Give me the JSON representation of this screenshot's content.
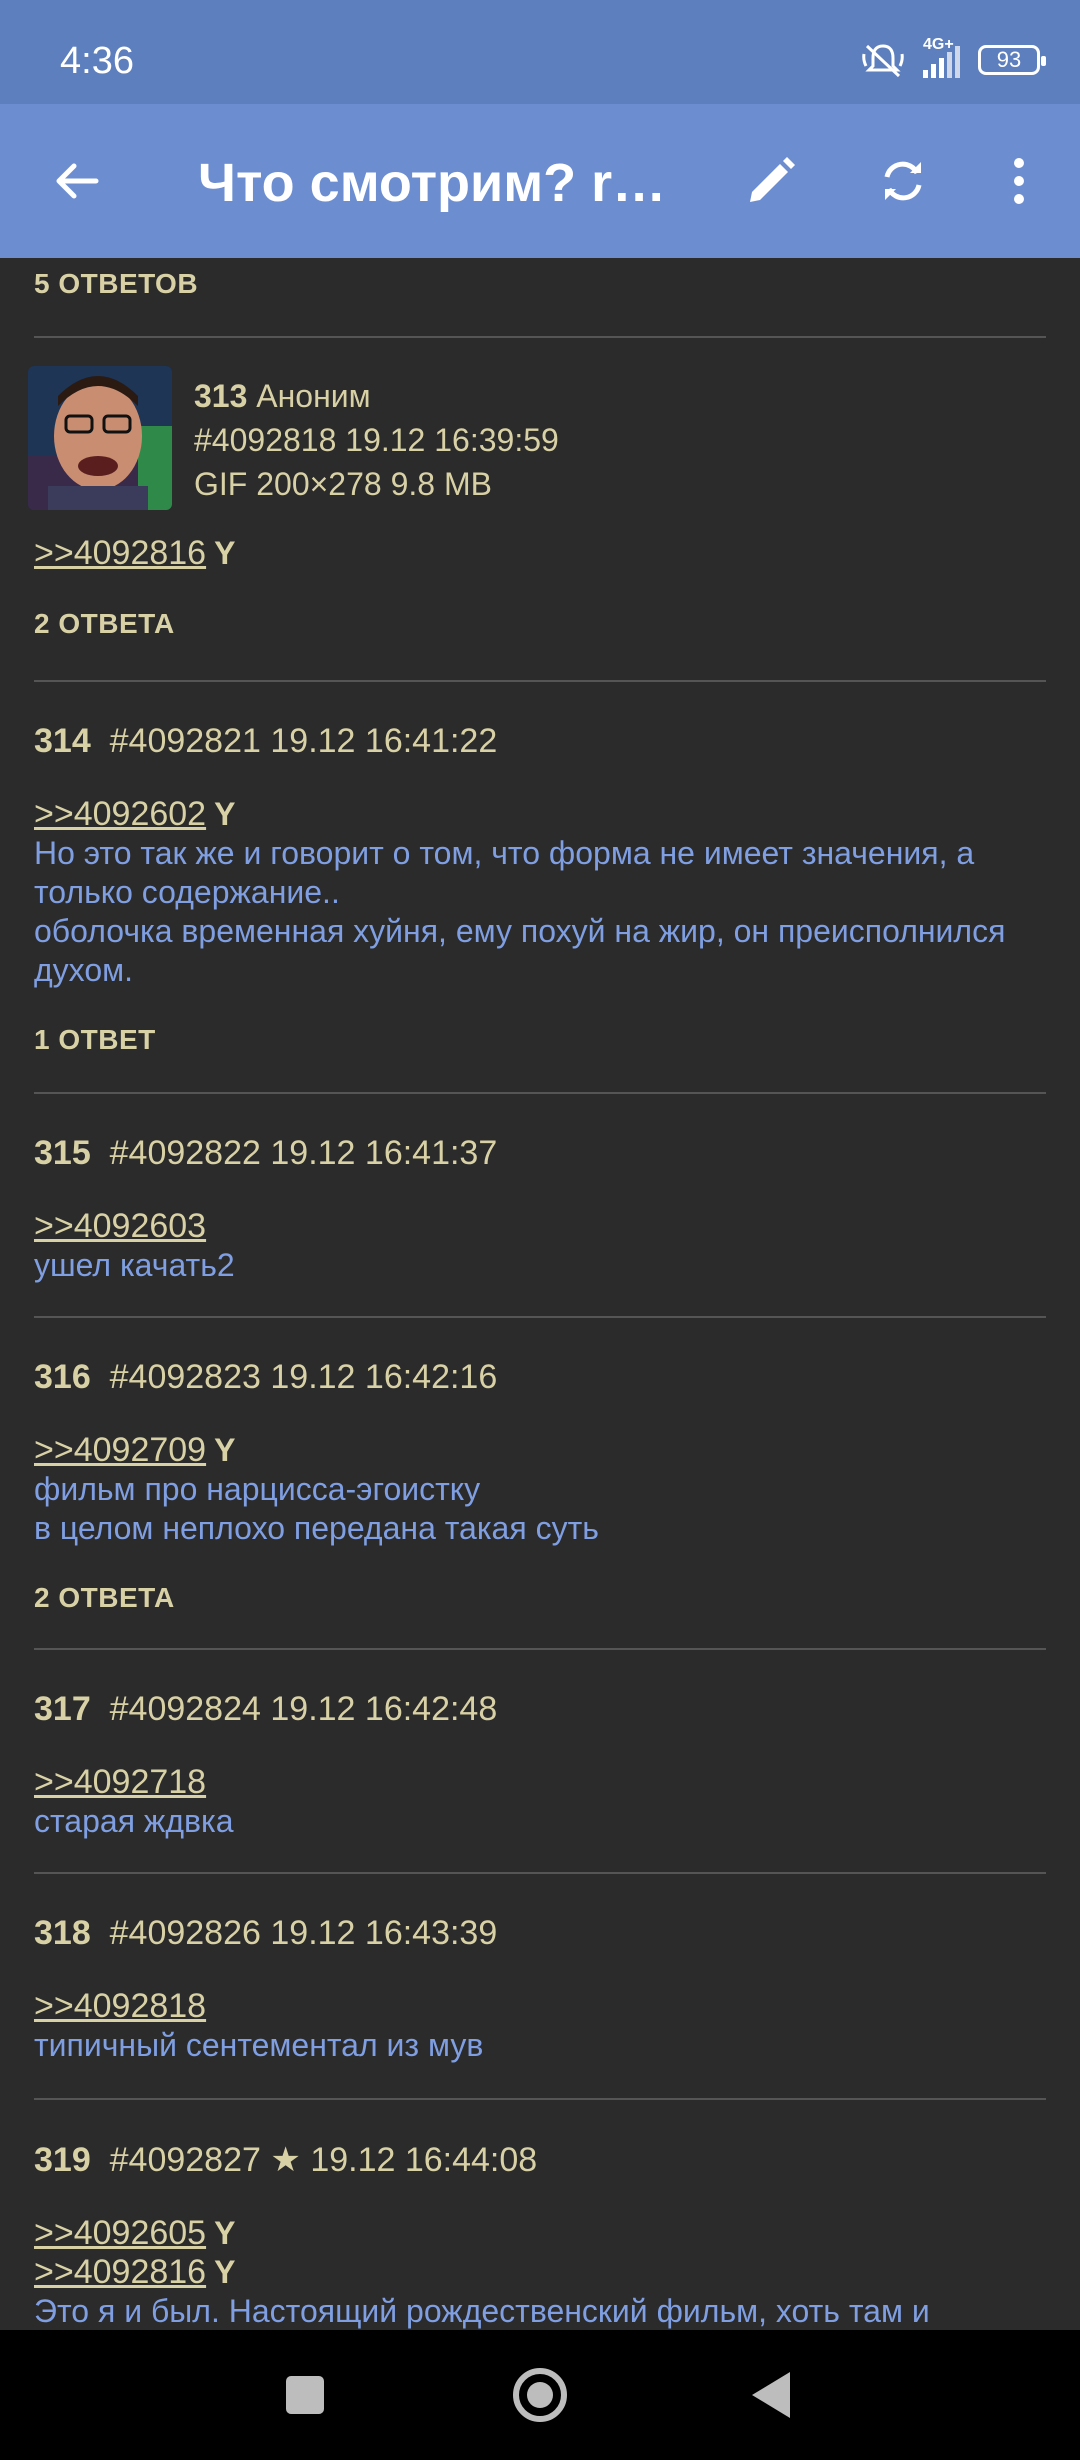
{
  "status_bar": {
    "time": "4:36",
    "network": "4G+",
    "battery": "93"
  },
  "app_bar": {
    "title": "Что смотрим? rev..."
  },
  "top_replies": "5 ОТВЕТОВ",
  "posts": [
    {
      "num": "313",
      "author": "Аноним",
      "id": "#4092818",
      "date": "19.12 16:39:59",
      "file": "GIF 200×278 9.8 MB",
      "quotes": [
        {
          "ref": ">>4092816",
          "you": "Y"
        }
      ],
      "text": [],
      "replies": "2 ОТВЕТА"
    },
    {
      "num": "314",
      "id": "#4092821",
      "date": "19.12 16:41:22",
      "quotes": [
        {
          "ref": ">>4092602",
          "you": "Y"
        }
      ],
      "text": [
        "Но это так же и говорит о том, что форма не имеет значения, а",
        "только содержание..",
        "оболочка временная хуйня, ему похуй на жир, он преисполнился",
        "духом."
      ],
      "replies": "1 ОТВЕТ"
    },
    {
      "num": "315",
      "id": "#4092822",
      "date": "19.12 16:41:37",
      "quotes": [
        {
          "ref": ">>4092603",
          "you": ""
        }
      ],
      "text": [
        "ушел качать2"
      ],
      "replies": ""
    },
    {
      "num": "316",
      "id": "#4092823",
      "date": "19.12 16:42:16",
      "quotes": [
        {
          "ref": ">>4092709",
          "you": "Y"
        }
      ],
      "text": [
        "фильм про нарцисса-эгоистку",
        "в целом неплохо передана такая суть"
      ],
      "replies": "2 ОТВЕТА"
    },
    {
      "num": "317",
      "id": "#4092824",
      "date": "19.12 16:42:48",
      "quotes": [
        {
          "ref": ">>4092718",
          "you": ""
        }
      ],
      "text": [
        "старая ждвка"
      ],
      "replies": ""
    },
    {
      "num": "318",
      "id": "#4092826",
      "date": "19.12 16:43:39",
      "quotes": [
        {
          "ref": ">>4092818",
          "you": ""
        }
      ],
      "text": [
        "типичный сентементал из мув"
      ],
      "replies": ""
    },
    {
      "num": "319",
      "id": "#4092827",
      "star": "★",
      "date": "19.12 16:44:08",
      "quotes": [
        {
          "ref": ">>4092605",
          "you": "Y"
        },
        {
          "ref": ">>4092816",
          "you": "Y"
        }
      ],
      "text": [
        "Это я и был. Настоящий рождественский фильм, хоть там и"
      ],
      "replies": ""
    }
  ]
}
